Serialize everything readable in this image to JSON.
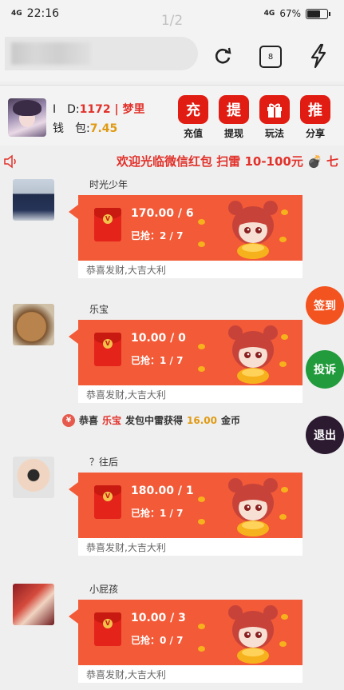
{
  "status": {
    "time": "22:16",
    "signal": "4G",
    "net": "4G",
    "battery": "67%",
    "battery_level": 0.67
  },
  "browser": {
    "pager": "1/2",
    "tab_count": "8"
  },
  "user": {
    "id_label": "I　D:",
    "id_value": "1172 | 梦里",
    "wallet_label": "钱　包:",
    "wallet_value": "7.45"
  },
  "actions": [
    {
      "icon": "充",
      "label": "充值"
    },
    {
      "icon": "提",
      "label": "提现"
    },
    {
      "icon": "gift",
      "label": "玩法"
    },
    {
      "icon": "推",
      "label": "分享"
    }
  ],
  "marquee": {
    "text": "欢迎光临微信红包 扫雷 10-100元 💣 七"
  },
  "messages": [
    {
      "name": "时光少年",
      "amount": "170.00 / 6",
      "grabbed": "已抢：2 / 7",
      "footer": "恭喜发财,大吉大利"
    },
    {
      "name": "乐宝",
      "amount": "10.00 / 0",
      "grabbed": "已抢：1 / 7",
      "footer": "恭喜发财,大吉大利"
    },
    {
      "name": "？往后",
      "amount": "180.00 / 1",
      "grabbed": "已抢：1 / 7",
      "footer": "恭喜发财,大吉大利"
    },
    {
      "name": "小屁孩",
      "amount": "10.00 / 3",
      "grabbed": "已抢：0 / 7",
      "footer": "恭喜发财,大吉大利"
    }
  ],
  "notice": {
    "prefix": "恭喜",
    "user": "乐宝",
    "middle": "发包中雷获得",
    "amount": "16.00",
    "suffix": "金币"
  },
  "float_buttons": {
    "checkin": "签到",
    "complain": "投诉",
    "exit": "退出"
  },
  "colors": {
    "accent_red": "#e11d13",
    "packet": "#f35a37",
    "checkin": "#f3531f",
    "complain": "#229b3c",
    "exit": "#2c1a31"
  }
}
